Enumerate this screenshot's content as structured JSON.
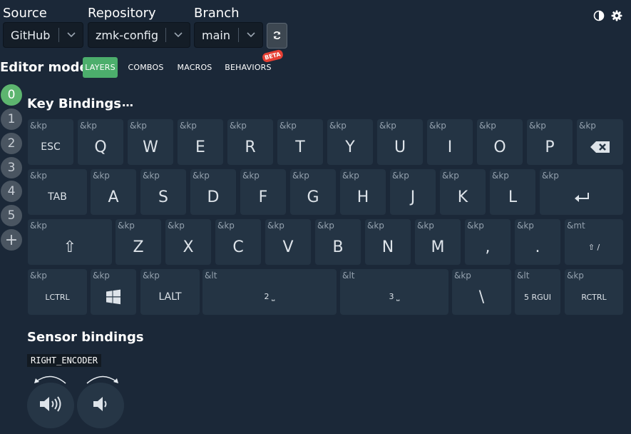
{
  "toolbar": {
    "source_label": "Source",
    "source_value": "GitHub",
    "repository_label": "Repository",
    "repository_value": "zmk-config",
    "branch_label": "Branch",
    "branch_value": "main"
  },
  "editor_mode": {
    "title": "Editor mode:",
    "modes": [
      "LAYERS",
      "COMBOS",
      "MACROS",
      "BEHAVIORS"
    ],
    "active": "LAYERS",
    "beta_badge": "BETA"
  },
  "layers": [
    "0",
    "1",
    "2",
    "3",
    "4",
    "5",
    "+"
  ],
  "key_bindings": {
    "title": "Key Bindings",
    "menu": "…"
  },
  "keys": [
    {
      "b": "&kp",
      "p": "ESC"
    },
    {
      "b": "&kp",
      "p": "Q"
    },
    {
      "b": "&kp",
      "p": "W"
    },
    {
      "b": "&kp",
      "p": "E"
    },
    {
      "b": "&kp",
      "p": "R"
    },
    {
      "b": "&kp",
      "p": "T"
    },
    {
      "b": "&kp",
      "p": "Y"
    },
    {
      "b": "&kp",
      "p": "U"
    },
    {
      "b": "&kp",
      "p": "I"
    },
    {
      "b": "&kp",
      "p": "O"
    },
    {
      "b": "&kp",
      "p": "P"
    },
    {
      "b": "&kp",
      "p": "backspace-icon"
    },
    {
      "b": "&kp",
      "p": "TAB"
    },
    {
      "b": "&kp",
      "p": "A"
    },
    {
      "b": "&kp",
      "p": "S"
    },
    {
      "b": "&kp",
      "p": "D"
    },
    {
      "b": "&kp",
      "p": "F"
    },
    {
      "b": "&kp",
      "p": "G"
    },
    {
      "b": "&kp",
      "p": "H"
    },
    {
      "b": "&kp",
      "p": "J"
    },
    {
      "b": "&kp",
      "p": "K"
    },
    {
      "b": "&kp",
      "p": "L"
    },
    {
      "b": "&kp",
      "p": "enter-icon"
    },
    {
      "b": "&kp",
      "p": "⇧"
    },
    {
      "b": "&kp",
      "p": "Z"
    },
    {
      "b": "&kp",
      "p": "X"
    },
    {
      "b": "&kp",
      "p": "C"
    },
    {
      "b": "&kp",
      "p": "V"
    },
    {
      "b": "&kp",
      "p": "B"
    },
    {
      "b": "&kp",
      "p": "N"
    },
    {
      "b": "&kp",
      "p": "M"
    },
    {
      "b": "&kp",
      "p": ","
    },
    {
      "b": "&kp",
      "p": "."
    },
    {
      "b": "&mt",
      "p": "⇧ /"
    },
    {
      "b": "&kp",
      "p": "LCTRL"
    },
    {
      "b": "&kp",
      "p": "windows-icon"
    },
    {
      "b": "&kp",
      "p": "LALT"
    },
    {
      "b": "&lt",
      "p": "2 ⎵"
    },
    {
      "b": "&lt",
      "p": "3 ⎵"
    },
    {
      "b": "&kp",
      "p": "\\"
    },
    {
      "b": "&lt",
      "p": "5 RGUI"
    },
    {
      "b": "&kp",
      "p": "RCTRL"
    }
  ],
  "sensor_bindings": {
    "title": "Sensor bindings",
    "encoder_name": "RIGHT_ENCODER",
    "actions": [
      "volume-up-icon",
      "volume-down-icon"
    ]
  },
  "colors": {
    "background": "#1b2838",
    "key": "#243444",
    "accent_green": "#4cae6c",
    "beta_red": "#e64034"
  }
}
